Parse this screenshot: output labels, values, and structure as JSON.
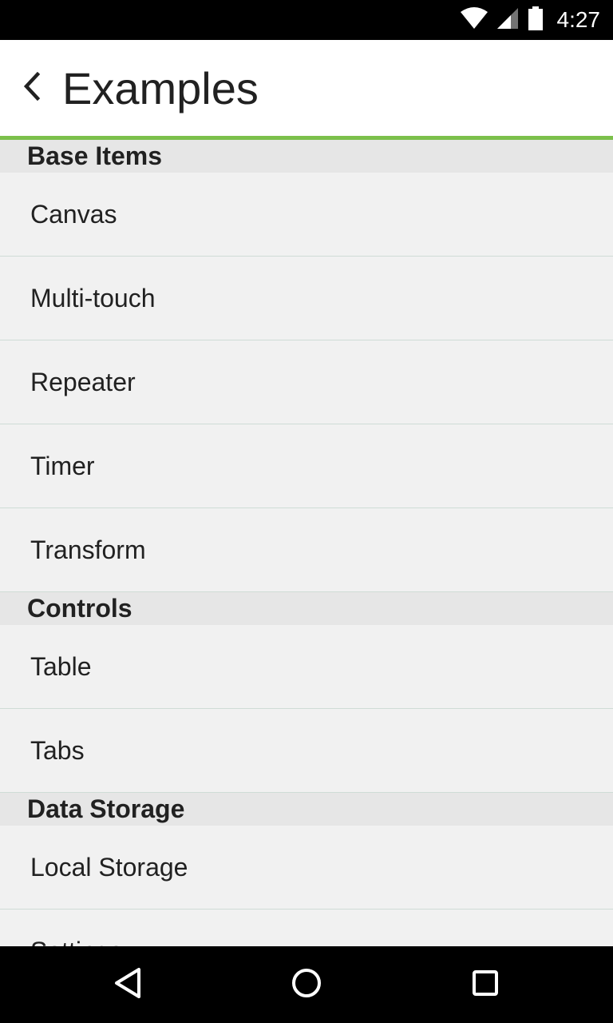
{
  "status_bar": {
    "time": "4:27",
    "icons": [
      "wifi-icon",
      "cell-signal-icon",
      "battery-icon"
    ]
  },
  "app_bar": {
    "title": "Examples",
    "back_icon": "chevron-left-icon"
  },
  "colors": {
    "accent": "#7cc04b",
    "background": "#f1f1f1",
    "section_header_bg": "#e6e6e6",
    "divider": "#cfdcd6"
  },
  "sections": [
    {
      "header": "Base Items",
      "items": [
        "Canvas",
        "Multi-touch",
        "Repeater",
        "Timer",
        "Transform"
      ]
    },
    {
      "header": "Controls",
      "items": [
        "Table",
        "Tabs"
      ]
    },
    {
      "header": "Data Storage",
      "items": [
        "Local Storage",
        "Settings"
      ]
    }
  ],
  "nav_bar": {
    "icons": [
      "back-triangle-icon",
      "home-circle-icon",
      "recents-square-icon"
    ]
  }
}
